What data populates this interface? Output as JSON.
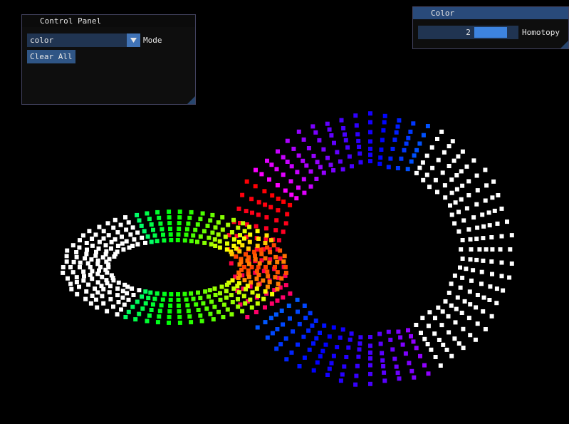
{
  "control_panel": {
    "title": "Control Panel",
    "mode_value": "color",
    "mode_label": "Mode",
    "clear_button": "Clear All"
  },
  "color_window": {
    "title": "Color",
    "homotopy_value": "2",
    "homotopy_label": "Homotopy",
    "homotopy_fraction": 0.85
  },
  "colors": {
    "window_bg": "#0f0f0f",
    "title_active": "#294a7a",
    "frame_bg": "#203451",
    "button": "#2f5585",
    "accent": "#3d84e0",
    "point_default": "#ffffff"
  }
}
